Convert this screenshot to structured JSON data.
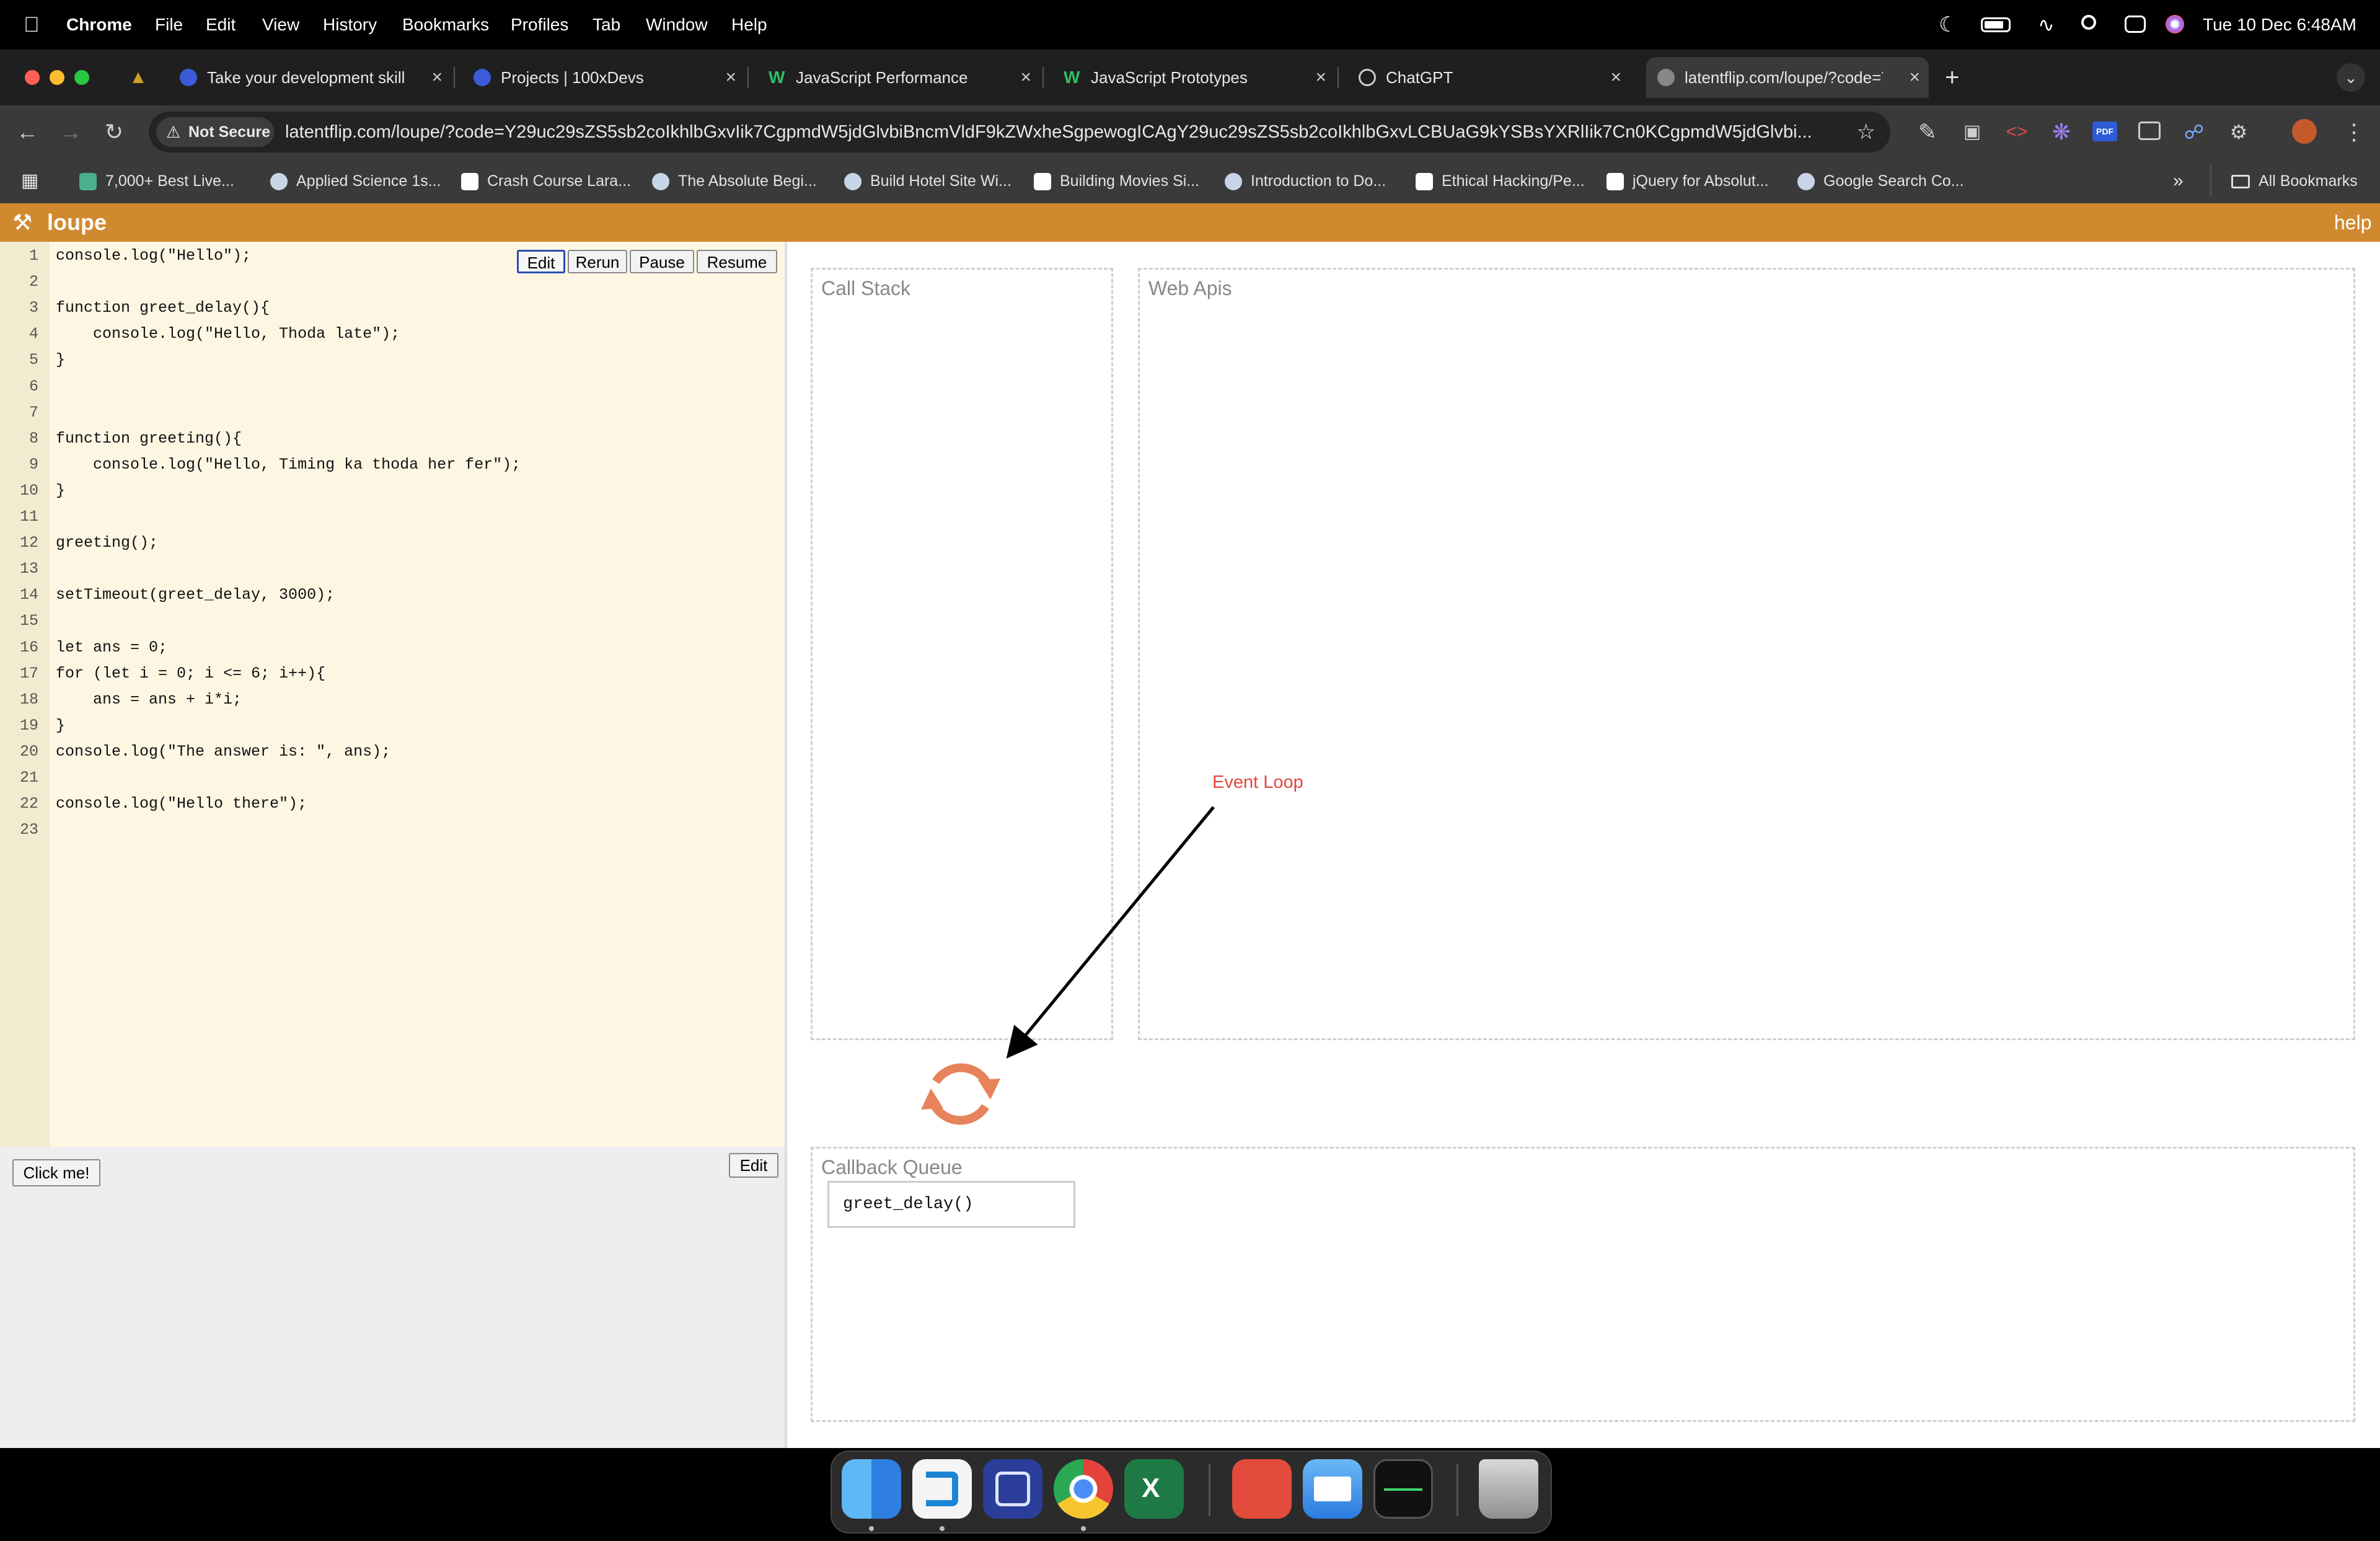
{
  "menubar": {
    "app": "Chrome",
    "items": [
      "File",
      "Edit",
      "View",
      "History",
      "Bookmarks",
      "Profiles",
      "Tab",
      "Window",
      "Help"
    ],
    "datetime": "Tue 10 Dec  6:48AM"
  },
  "tabs": [
    {
      "title": "Take your development skills",
      "active": false
    },
    {
      "title": "Projects | 100xDevs",
      "active": false
    },
    {
      "title": "JavaScript Performance",
      "active": false
    },
    {
      "title": "JavaScript Prototypes",
      "active": false
    },
    {
      "title": "ChatGPT",
      "active": false
    },
    {
      "title": "latentflip.com/loupe/?code=Y",
      "active": true
    }
  ],
  "omnibox": {
    "security": "Not Secure",
    "url": "latentflip.com/loupe/?code=Y29uc29sZS5sb2coIkhlbGxvIik7CgpmdW5jdGlvbiBncmVldF9kZWxheSgpewogICAgY29uc29sZS5sb2coIkhlbGxvLCBUaG9kYSBsYXRlIik7Cn0KCgpmdW5jdGlvbi..."
  },
  "bookmarks": {
    "items": [
      "7,000+ Best Live...",
      "Applied Science 1s...",
      "Crash Course Lara...",
      "The Absolute Begi...",
      "Build Hotel Site Wi...",
      "Building Movies Si...",
      "Introduction to Do...",
      "Ethical Hacking/Pe...",
      "jQuery for Absolut...",
      "Google Search Co..."
    ],
    "all_label": "All Bookmarks"
  },
  "loupe": {
    "title": "loupe",
    "help": "help"
  },
  "editor": {
    "buttons": {
      "edit": "Edit",
      "rerun": "Rerun",
      "pause": "Pause",
      "resume": "Resume"
    },
    "lines": [
      "console.log(\"Hello\");",
      "",
      "function greet_delay(){",
      "    console.log(\"Hello, Thoda late\");",
      "}",
      "",
      "",
      "function greeting(){",
      "    console.log(\"Hello, Timing ka thoda her fer\");",
      "}",
      "",
      "greeting();",
      "",
      "setTimeout(greet_delay, 3000);",
      "",
      "let ans = 0;",
      "for (let i = 0; i <= 6; i++){",
      "    ans = ans + i*i;",
      "}",
      "console.log(\"The answer is: \", ans);",
      "",
      "console.log(\"Hello there\");",
      ""
    ]
  },
  "html_pane": {
    "click_button": "Click me!",
    "edit_button": "Edit"
  },
  "viz": {
    "call_stack": "Call Stack",
    "web_apis": "Web Apis",
    "callback_queue": "Callback Queue",
    "queue_items": [
      "greet_delay()"
    ],
    "annotation": "Event Loop",
    "annotation_color": "#e4463c",
    "loop_color": "#e8825a"
  },
  "colors": {
    "loupe_orange": "#d1892f",
    "editor_bg": "#fdf6e3"
  }
}
